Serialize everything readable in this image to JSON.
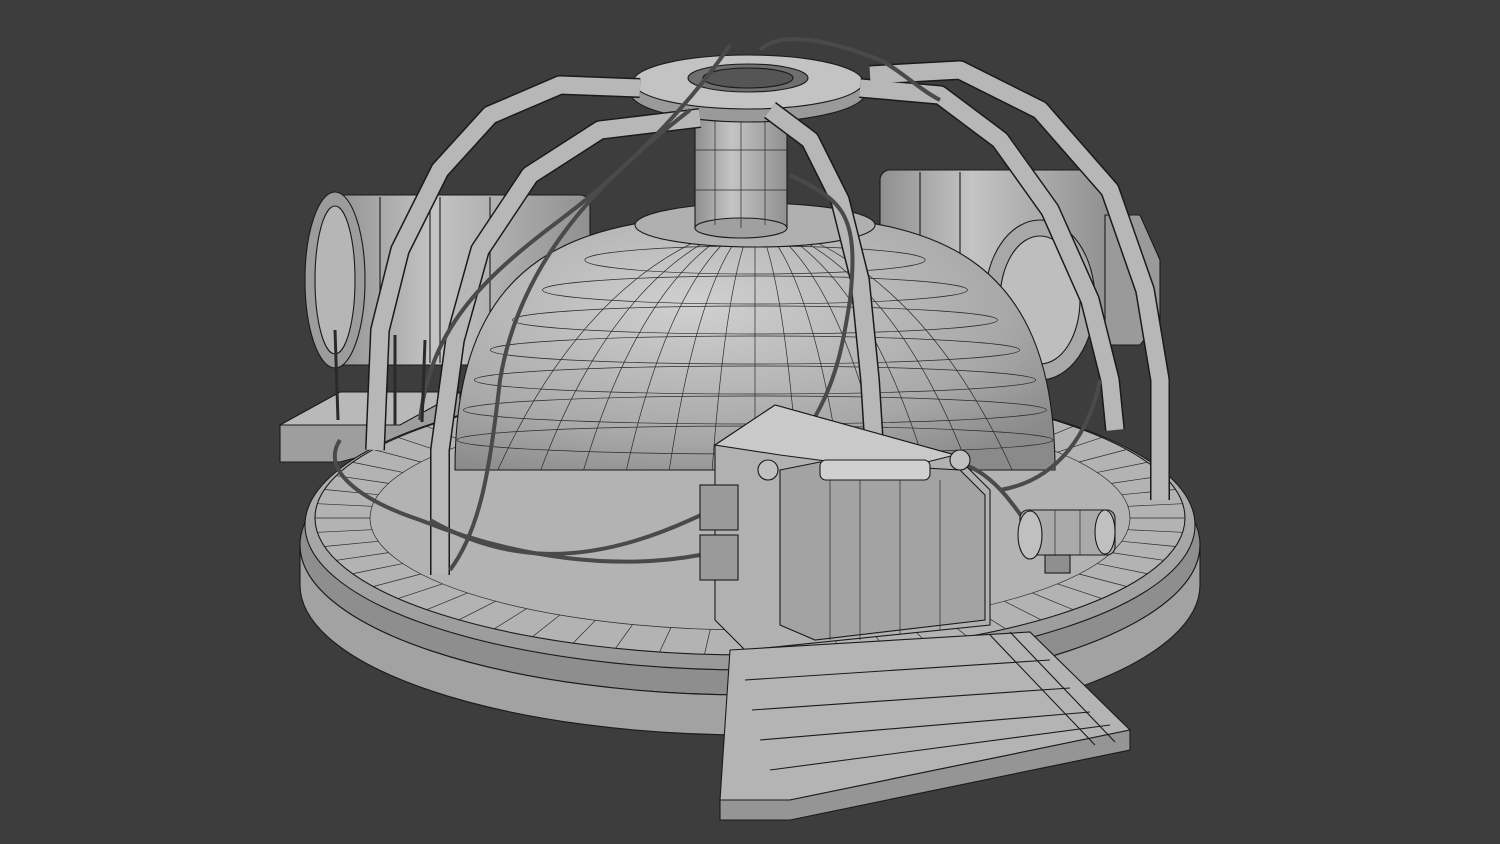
{
  "scene": {
    "subject": "wireframe-dome-structure",
    "background_color": "#3d3d3d",
    "mesh_fill": "#a9a9a9",
    "mesh_fill_light": "#c2c2c2",
    "mesh_fill_dark": "#858585",
    "wire_color": "#1a1a1a"
  }
}
